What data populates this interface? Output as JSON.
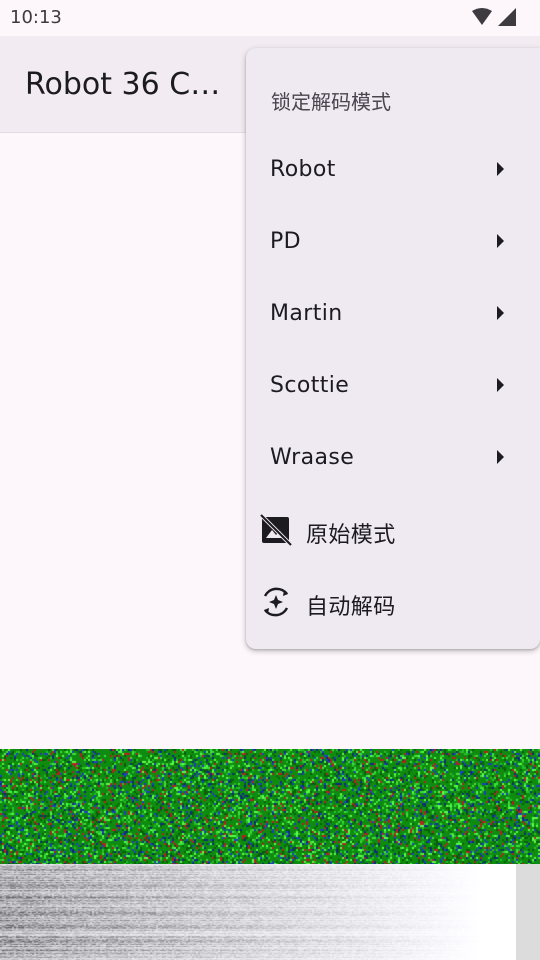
{
  "status_bar": {
    "time": "10:13",
    "icons": [
      "wifi-icon",
      "signal-icon"
    ]
  },
  "app_bar": {
    "title": "Robot 36 Co..."
  },
  "menu": {
    "header": "锁定解码模式",
    "submenus": [
      {
        "label": "Robot"
      },
      {
        "label": "PD"
      },
      {
        "label": "Martin"
      },
      {
        "label": "Scottie"
      },
      {
        "label": "Wraase"
      }
    ],
    "actions": [
      {
        "label": "原始模式",
        "icon": "hide-image-icon"
      },
      {
        "label": "自动解码",
        "icon": "auto-decode-icon"
      }
    ]
  },
  "colors": {
    "background": "#fdf7fc",
    "app_bar": "#f2ecf2",
    "menu_surface": "#efe9f1",
    "waterfall_green": "#0f8c10"
  }
}
